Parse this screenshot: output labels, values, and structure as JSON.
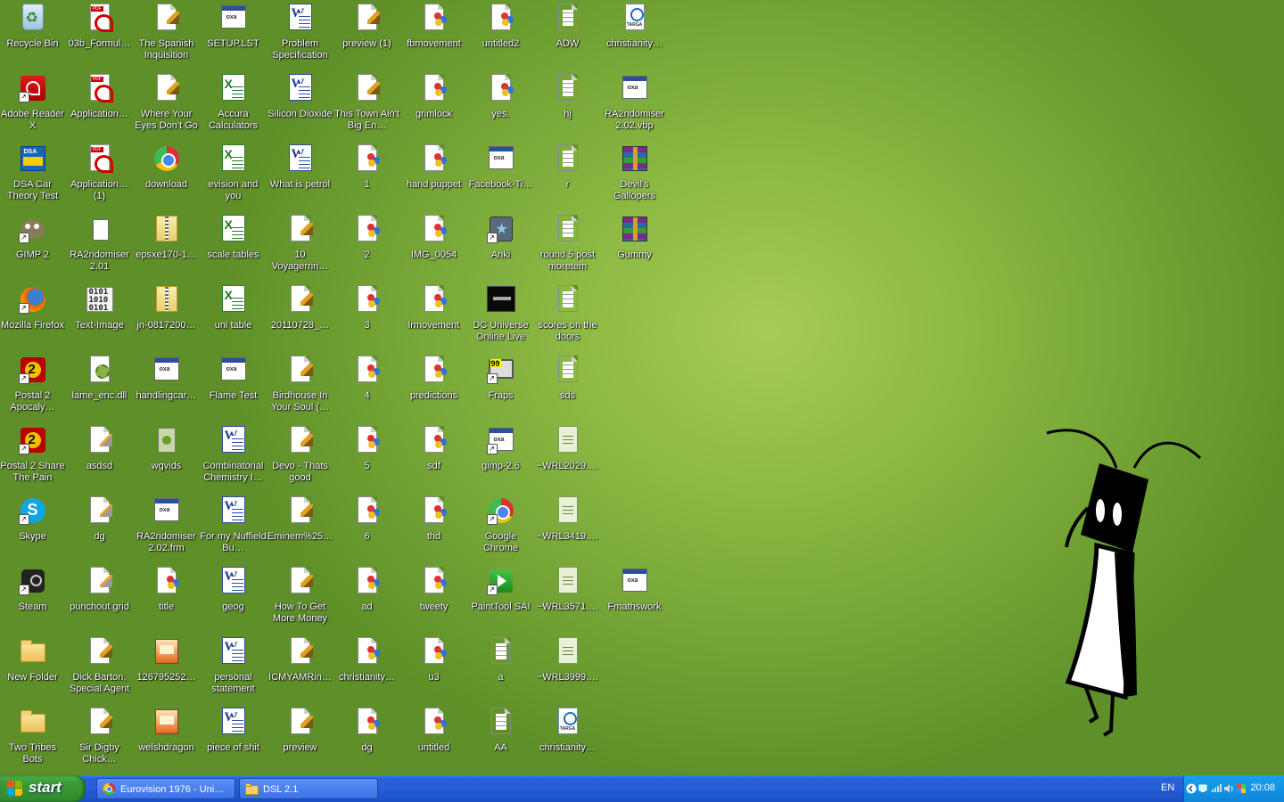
{
  "desktop": {
    "columns": [
      [
        {
          "label": "Recycle Bin",
          "type": "recycle"
        },
        {
          "label": "Adobe Reader X",
          "type": "acrobat",
          "shortcut": true
        },
        {
          "label": "DSA Car Theory Test",
          "type": "dsa"
        },
        {
          "label": "GIMP 2",
          "type": "gimp",
          "shortcut": true
        },
        {
          "label": "Mozilla Firefox",
          "type": "firefox",
          "shortcut": true
        },
        {
          "label": "Postal 2 Apocaly…",
          "type": "postal",
          "shortcut": true
        },
        {
          "label": "Postal 2 Share The Pain",
          "type": "postal",
          "shortcut": true
        },
        {
          "label": "Skype",
          "type": "skype",
          "shortcut": true
        },
        {
          "label": "Steam",
          "type": "steam",
          "shortcut": true
        },
        {
          "label": "New Folder",
          "type": "folder"
        },
        {
          "label": "Two Tribes Bots",
          "type": "folder"
        }
      ],
      [
        {
          "label": "03b_Formul…",
          "type": "pdf"
        },
        {
          "label": "Application…",
          "type": "pdf"
        },
        {
          "label": "Application… (1)",
          "type": "pdf"
        },
        {
          "label": "RA2ndomiser 2.01",
          "type": "bluebin"
        },
        {
          "label": "Text-Image",
          "type": "binary"
        },
        {
          "label": "lame_enc.dll",
          "type": "dll"
        },
        {
          "label": "asdsd",
          "type": "pencil"
        },
        {
          "label": "dg",
          "type": "pencil"
        },
        {
          "label": "punchout grid",
          "type": "pencil"
        },
        {
          "label": "Dick Barton, Special Agent",
          "type": "audio"
        },
        {
          "label": "Sir Digby Chick…",
          "type": "audio"
        }
      ],
      [
        {
          "label": "The Spanish Inquisition",
          "type": "audio"
        },
        {
          "label": "Where Your Eyes Don't Go",
          "type": "audio"
        },
        {
          "label": "download",
          "type": "chrome"
        },
        {
          "label": "epsxe170-1…",
          "type": "zip"
        },
        {
          "label": "jn-0817200…",
          "type": "zip"
        },
        {
          "label": "handlingcar…",
          "type": "window"
        },
        {
          "label": "wgvids",
          "type": "wg"
        },
        {
          "label": "RA2ndomiser 2.02.frm",
          "type": "window"
        },
        {
          "label": "title",
          "type": "paint"
        },
        {
          "label": "126795252…",
          "type": "img"
        },
        {
          "label": "welshdragon",
          "type": "img"
        }
      ],
      [
        {
          "label": "SETUP.LST",
          "type": "window"
        },
        {
          "label": "Accura Calculators",
          "type": "xls"
        },
        {
          "label": "evision and you",
          "type": "xls"
        },
        {
          "label": "scale tables",
          "type": "xls"
        },
        {
          "label": "uni table",
          "type": "xls"
        },
        {
          "label": "Flame Test",
          "type": "window"
        },
        {
          "label": "Combinatorial Chemistry I…",
          "type": "word"
        },
        {
          "label": "For my Nuffield Bu…",
          "type": "word"
        },
        {
          "label": "geog",
          "type": "word"
        },
        {
          "label": "personal statement",
          "type": "word"
        },
        {
          "label": "piece of shit",
          "type": "word"
        }
      ],
      [
        {
          "label": "Problem Specification",
          "type": "word"
        },
        {
          "label": "Silicon Dioxide",
          "type": "word"
        },
        {
          "label": "What is petrol",
          "type": "word"
        },
        {
          "label": "10 Voyagerrin…",
          "type": "audio"
        },
        {
          "label": "20110728_…",
          "type": "audio"
        },
        {
          "label": "Birdhouse In Your Soul (…",
          "type": "audio"
        },
        {
          "label": "Devo - Thats good",
          "type": "audio"
        },
        {
          "label": "Eminem%25…",
          "type": "audio"
        },
        {
          "label": "How To Get More Money",
          "type": "audio"
        },
        {
          "label": "ICMYAMRin…",
          "type": "audio"
        },
        {
          "label": "preview",
          "type": "audio"
        }
      ],
      [
        {
          "label": "preview (1)",
          "type": "audio"
        },
        {
          "label": "This Town Ain't Big En…",
          "type": "audio"
        },
        {
          "label": "1",
          "type": "paint"
        },
        {
          "label": "2",
          "type": "paint"
        },
        {
          "label": "3",
          "type": "paint"
        },
        {
          "label": "4",
          "type": "paint"
        },
        {
          "label": "5",
          "type": "paint"
        },
        {
          "label": "6",
          "type": "paint"
        },
        {
          "label": "ad",
          "type": "paint"
        },
        {
          "label": "christianity…",
          "type": "paint"
        },
        {
          "label": "dg",
          "type": "paint"
        }
      ],
      [
        {
          "label": "fbmovement",
          "type": "paint"
        },
        {
          "label": "grimlock",
          "type": "paint"
        },
        {
          "label": "hand puppet",
          "type": "paint"
        },
        {
          "label": "IMG_0054",
          "type": "paint"
        },
        {
          "label": "lrmovement",
          "type": "paint"
        },
        {
          "label": "predictions",
          "type": "paint"
        },
        {
          "label": "sdf",
          "type": "paint"
        },
        {
          "label": "thd",
          "type": "paint"
        },
        {
          "label": "tweety",
          "type": "paint"
        },
        {
          "label": "u3",
          "type": "paint"
        },
        {
          "label": "untitled",
          "type": "paint"
        }
      ],
      [
        {
          "label": "untitled2",
          "type": "paint"
        },
        {
          "label": "yes.",
          "type": "paint"
        },
        {
          "label": "Facebook-Ti…",
          "type": "window"
        },
        {
          "label": "Anki",
          "type": "anki",
          "shortcut": true
        },
        {
          "label": "DC Universe Online Live",
          "type": "dcuo"
        },
        {
          "label": "Fraps",
          "type": "fraps",
          "shortcut": true
        },
        {
          "label": "gimp-2.6",
          "type": "window",
          "shortcut": true
        },
        {
          "label": "Google Chrome",
          "type": "chrome",
          "shortcut": true
        },
        {
          "label": "PaintTool SAI",
          "type": "sai",
          "shortcut": true
        },
        {
          "label": "a",
          "type": "text"
        },
        {
          "label": "AA",
          "type": "text"
        }
      ],
      [
        {
          "label": "ADW",
          "type": "text"
        },
        {
          "label": "hj",
          "type": "text"
        },
        {
          "label": "r",
          "type": "text"
        },
        {
          "label": "round 5 post moretem",
          "type": "text"
        },
        {
          "label": "scores on the doors",
          "type": "text"
        },
        {
          "label": "sds",
          "type": "text"
        },
        {
          "label": "~WRL2029.…",
          "type": "wrl"
        },
        {
          "label": "~WRL3419.…",
          "type": "wrl"
        },
        {
          "label": "~WRL3571.…",
          "type": "wrl"
        },
        {
          "label": "~WRL3999.…",
          "type": "wrl"
        },
        {
          "label": "christianity…",
          "type": "targa"
        }
      ],
      [
        {
          "label": "christianity…",
          "type": "targa"
        },
        {
          "label": "RA2ndomiser 2.02.vbp",
          "type": "window"
        },
        {
          "label": "Devil's Gallopers",
          "type": "rar"
        },
        {
          "label": "Gummy",
          "type": "rar"
        },
        null,
        null,
        null,
        null,
        {
          "label": "Fmathswork",
          "type": "window"
        },
        null,
        null
      ]
    ]
  },
  "taskbar": {
    "start_label": "start",
    "tasks": [
      {
        "label": "Eurovision 1976 - Uni…",
        "icon": "chrome-icon"
      },
      {
        "label": "DSL 2.1",
        "icon": "folder-icon"
      }
    ],
    "tray": {
      "language": "EN",
      "time": "20:08"
    }
  }
}
